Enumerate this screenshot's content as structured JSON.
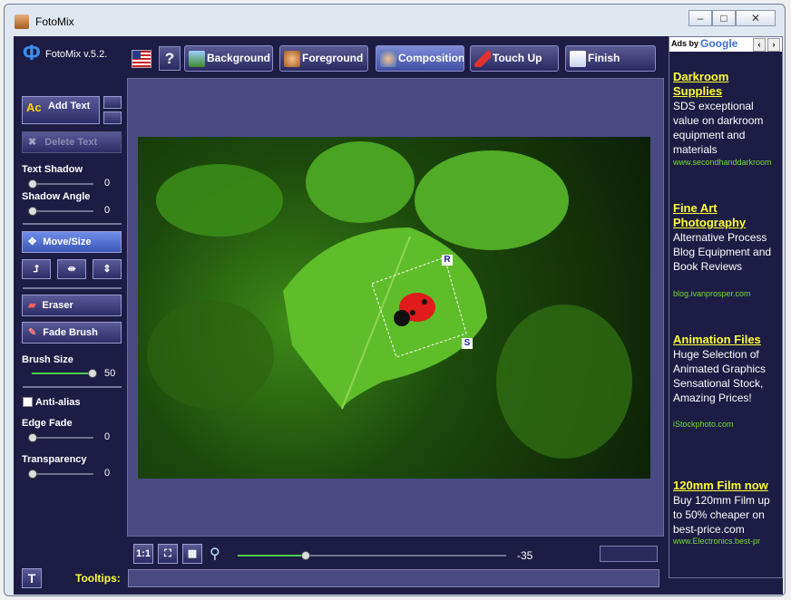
{
  "window": {
    "title": "FotoMix"
  },
  "app": {
    "version": "FotoMix v.5.2."
  },
  "tabs": [
    {
      "label": "Background"
    },
    {
      "label": "Foreground"
    },
    {
      "label": "Composition"
    },
    {
      "label": "Touch Up"
    },
    {
      "label": "Finish"
    }
  ],
  "left": {
    "add_text": "Add Text",
    "delete_text": "Delete Text",
    "text_shadow_label": "Text Shadow",
    "text_shadow_value": "0",
    "shadow_angle_label": "Shadow Angle",
    "shadow_angle_value": "0",
    "move_size": "Move/Size",
    "eraser": "Eraser",
    "fade_brush": "Fade Brush",
    "brush_size_label": "Brush Size",
    "brush_size_value": "50",
    "anti_alias": "Anti-alias",
    "edge_fade_label": "Edge Fade",
    "edge_fade_value": "0",
    "transparency_label": "Transparency",
    "transparency_value": "0",
    "tooltips_label": "Tooltips:"
  },
  "canvas": {
    "handle_r": "R",
    "handle_s": "S"
  },
  "bottom": {
    "zoom_value": "-35",
    "one_to_one": "1:1"
  },
  "ads": {
    "header": "Ads by",
    "brand": "Google",
    "items": [
      {
        "title": "Darkroom Supplies",
        "body": "SDS exceptional value on darkroom equipment and materials",
        "url": "www.secondhanddarkroom"
      },
      {
        "title": "Fine Art Photography",
        "body": "Alternative Process Blog Equipment and Book Reviews",
        "url": "blog.ivanprosper.com"
      },
      {
        "title": "Animation Files",
        "body": "Huge Selection of Animated Graphics Sensational Stock, Amazing Prices!",
        "url": "iStockphoto.com"
      },
      {
        "title": "120mm Film now",
        "body": "Buy 120mm Film up to 50% cheaper on best-price.com",
        "url": "www.Electronics.best-pr"
      }
    ]
  },
  "colors": {
    "accent": "#ffff33",
    "url_green": "#77dd33",
    "panel": "#1c1c44"
  }
}
